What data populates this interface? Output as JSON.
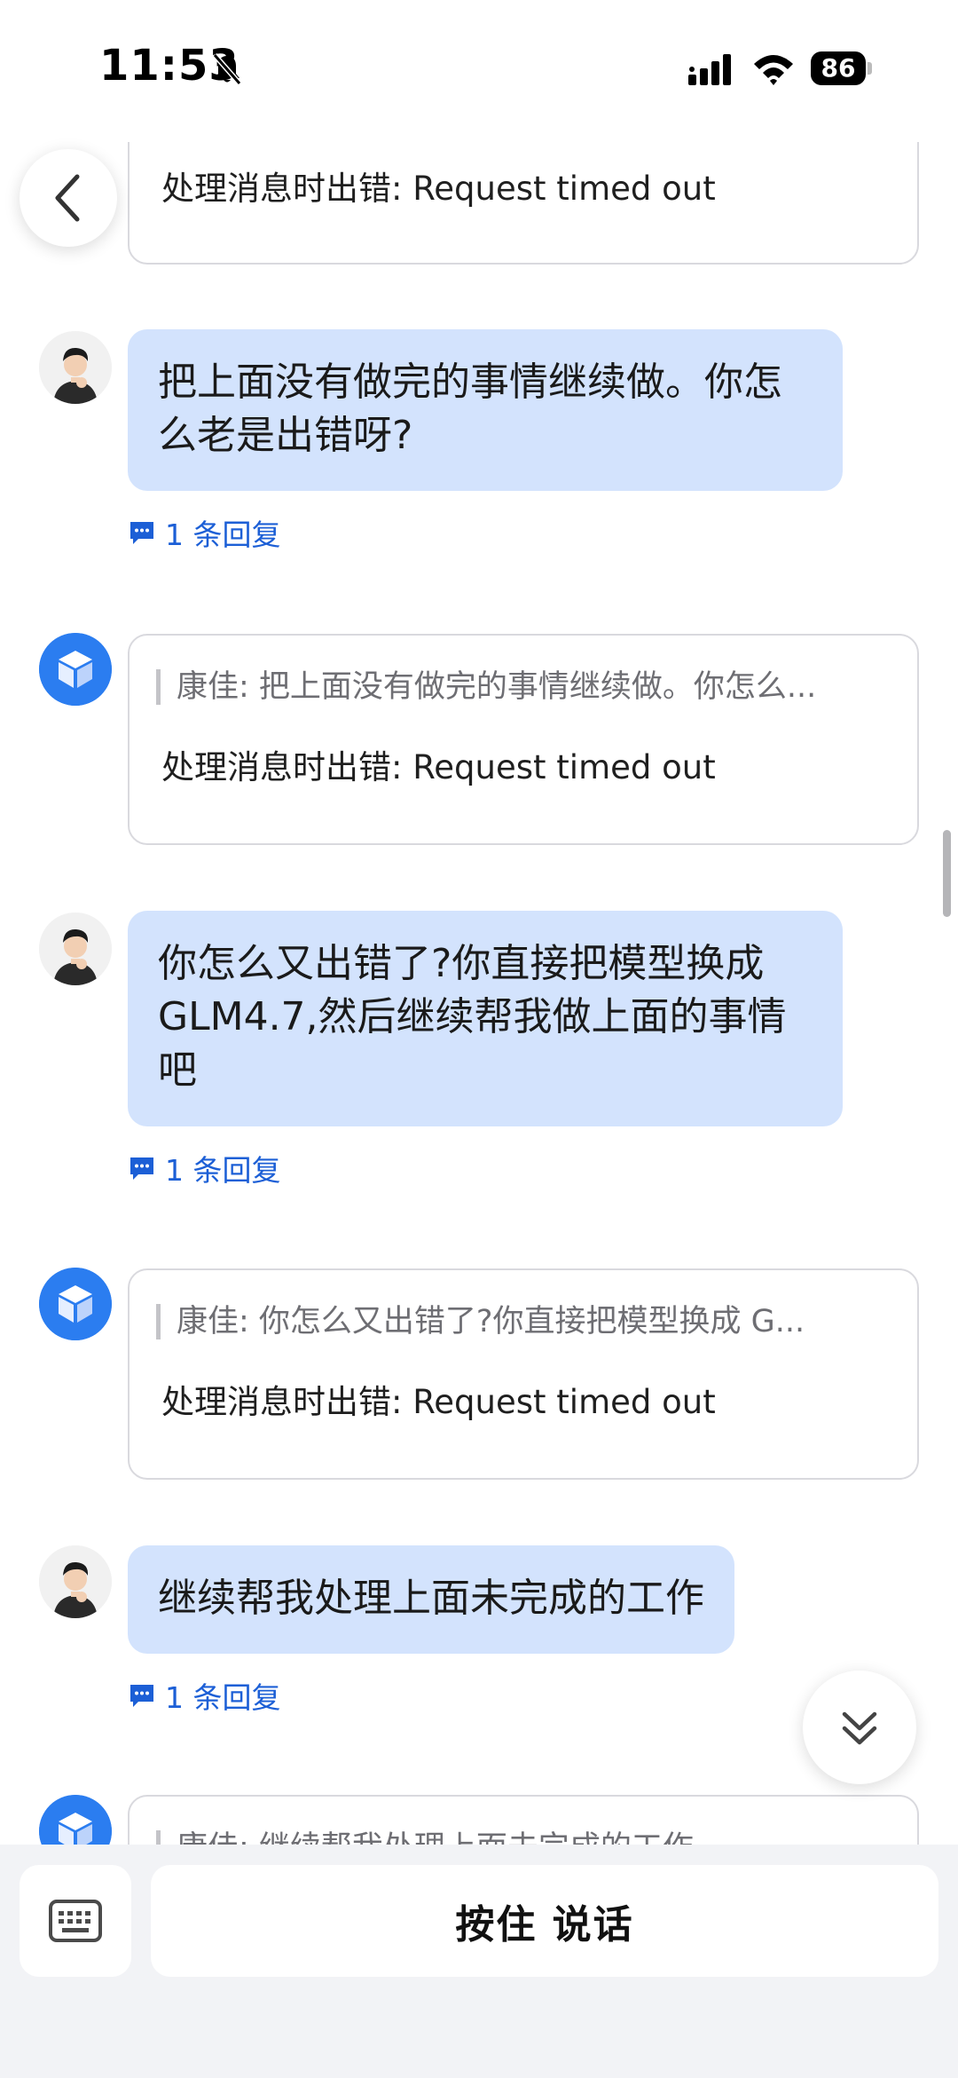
{
  "status_bar": {
    "time": "11:53",
    "battery": "86"
  },
  "messages": [
    {
      "type": "bot",
      "quote": "",
      "text": "处理消息时出错: Request timed out"
    },
    {
      "type": "user",
      "text": "把上面没有做完的事情继续做。你怎么老是出错呀?",
      "reply": "1 条回复"
    },
    {
      "type": "bot",
      "quote": "康佳: 把上面没有做完的事情继续做。你怎么...",
      "text": "处理消息时出错: Request timed out"
    },
    {
      "type": "user",
      "text": "你怎么又出错了?你直接把模型换成 GLM4.7,然后继续帮我做上面的事情吧",
      "reply": "1 条回复"
    },
    {
      "type": "bot",
      "quote": "康佳: 你怎么又出错了?你直接把模型换成 G...",
      "text": "处理消息时出错: Request timed out"
    },
    {
      "type": "user",
      "text": "继续帮我处理上面未完成的工作",
      "reply": "1 条回复"
    },
    {
      "type": "bot",
      "quote": "康佳: 继续帮我处理上面未完成的工作",
      "text": ""
    }
  ],
  "input_bar": {
    "hold_to_talk": "按住 说话"
  },
  "colors": {
    "user_bubble": "#d3e3fd",
    "link_blue": "#1c5fd6",
    "bot_avatar": "#2b7df0"
  }
}
